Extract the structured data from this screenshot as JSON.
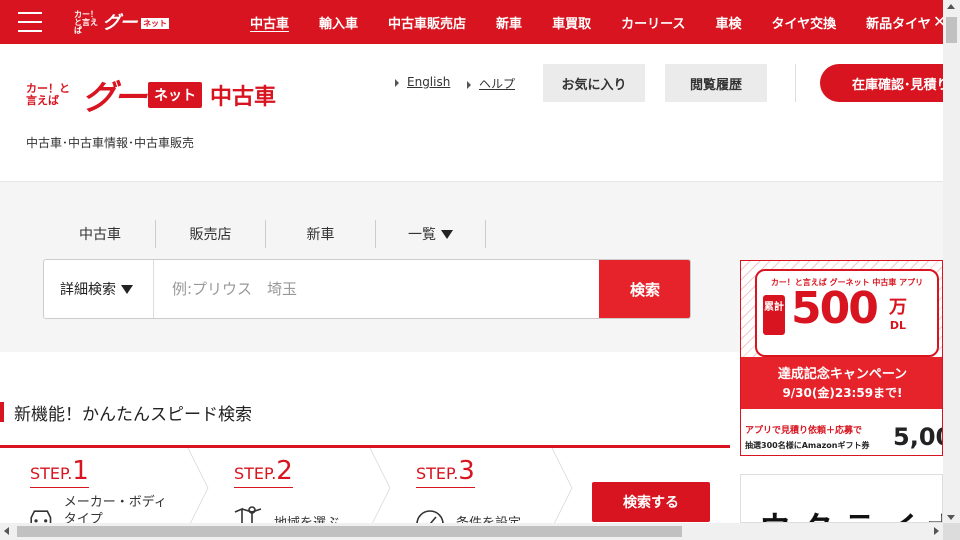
{
  "top_bar": {
    "logo": {
      "small": "カー！と言えば",
      "big": "グー",
      "net": "ネット"
    },
    "nav": [
      "中古車",
      "輸入車",
      "中古車販売店",
      "新車",
      "車買取",
      "カーリース",
      "車検",
      "タイヤ交換",
      "新品タイヤ"
    ],
    "close_glyph": "✕"
  },
  "header": {
    "logo": {
      "small": "カー！と言えば",
      "big": "グー",
      "net": "ネット",
      "category": "中古車"
    },
    "tagline": "中古車･中古車情報･中古車販売",
    "links": [
      "English",
      "ヘルプ"
    ],
    "buttons": [
      "お気に入り",
      "閲覧履歴"
    ],
    "stock_button": "在庫確認･見積り"
  },
  "search": {
    "tabs": [
      "中古車",
      "販売店",
      "新車",
      "一覧"
    ],
    "detail_dropdown": "詳細検索",
    "placeholder": "例:プリウス　埼玉",
    "value": "",
    "button": "検索"
  },
  "banner": {
    "app_line": "カー！と言えば グーネット 中古車 アプリ",
    "total_label": "累計",
    "count": "500",
    "unit": "万",
    "unit_sub": "DL",
    "campaign": "達成記念キャンペーン",
    "deadline": "9/30(金)23:59まで!",
    "line1": "アプリで見積り依頼＋応募で",
    "line2": "抽選300名様にAmazonギフト券",
    "amount": "5,00"
  },
  "banner2": {
    "text": "ウクライナ"
  },
  "speed_search": {
    "title": "新機能！かんたんスピード検索",
    "steps": [
      {
        "prefix": "STEP.",
        "num": "1",
        "label": "メーカー・ボディタイプ"
      },
      {
        "prefix": "STEP.",
        "num": "2",
        "label": "地域を選ぶ"
      },
      {
        "prefix": "STEP.",
        "num": "3",
        "label": "条件を設定"
      }
    ],
    "button": "検索する"
  },
  "colors": {
    "brand_red": "#d7141f",
    "search_red": "#e6232b",
    "panel_gray": "#f5f5f5"
  }
}
